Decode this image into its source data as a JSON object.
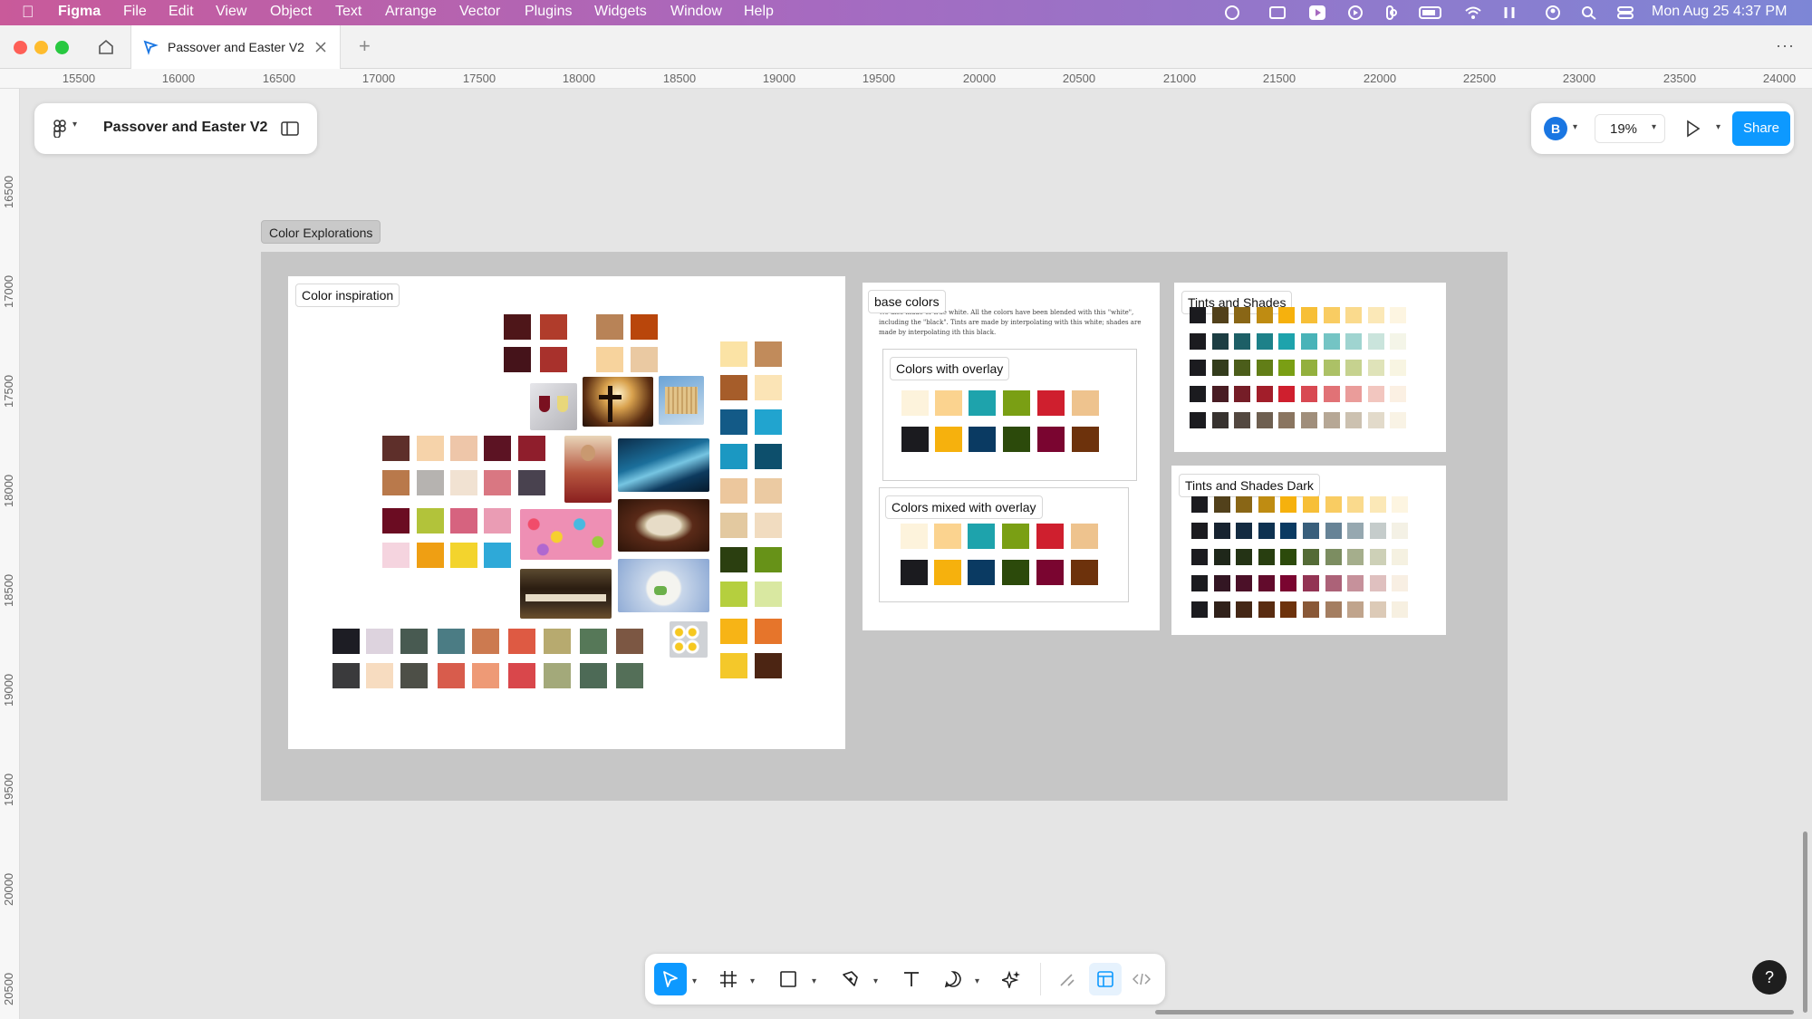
{
  "menubar": {
    "app": "Figma",
    "items": [
      "File",
      "Edit",
      "View",
      "Object",
      "Text",
      "Arrange",
      "Vector",
      "Plugins",
      "Widgets",
      "Window",
      "Help"
    ],
    "clock": "Mon Aug 25  4:37 PM"
  },
  "tab": {
    "title": "Passover and Easter V2",
    "new_tab": "+",
    "more": "···"
  },
  "ruler": {
    "top": [
      "15500",
      "16000",
      "16500",
      "17000",
      "17500",
      "18000",
      "18500",
      "19000",
      "19500",
      "20000",
      "20500",
      "21000",
      "21500",
      "22000",
      "22500",
      "23000",
      "23500",
      "24000"
    ],
    "left": [
      "16500",
      "17000",
      "17500",
      "18000",
      "18500",
      "19000",
      "19500",
      "20000",
      "20500"
    ]
  },
  "file_panel": {
    "name": "Passover and Easter V2"
  },
  "right_panel": {
    "avatar": "B",
    "zoom": "19%",
    "share": "Share"
  },
  "canvas": {
    "section_label": "Color Explorations",
    "frames": {
      "inspiration": "Color inspiration",
      "base": "base colors",
      "base_desc": "We also made of true white. All the colors have been blended with this \"white\", including the \"black\". Tints are made by interpolating with this white; shades are made by interpolating ith this black.",
      "overlay": "Colors with overlay",
      "mixed": "Colors mixed with overlay",
      "tints": "Tints and Shades",
      "tints_dark": "Tints and Shades Dark"
    },
    "palette": {
      "cream": "#fdf3dc",
      "sand": "#fbd38f",
      "teal": "#1ea3ac",
      "olive": "#7a9f14",
      "red": "#cf1f2e",
      "tan": "#eec38e",
      "black": "#1b1b1f",
      "gold": "#f6b10d",
      "navy": "#0a3a62",
      "forest": "#2c4a0b",
      "wine": "#7a0530",
      "brown": "#6d320c"
    }
  },
  "toolbar": {
    "help": "?"
  }
}
